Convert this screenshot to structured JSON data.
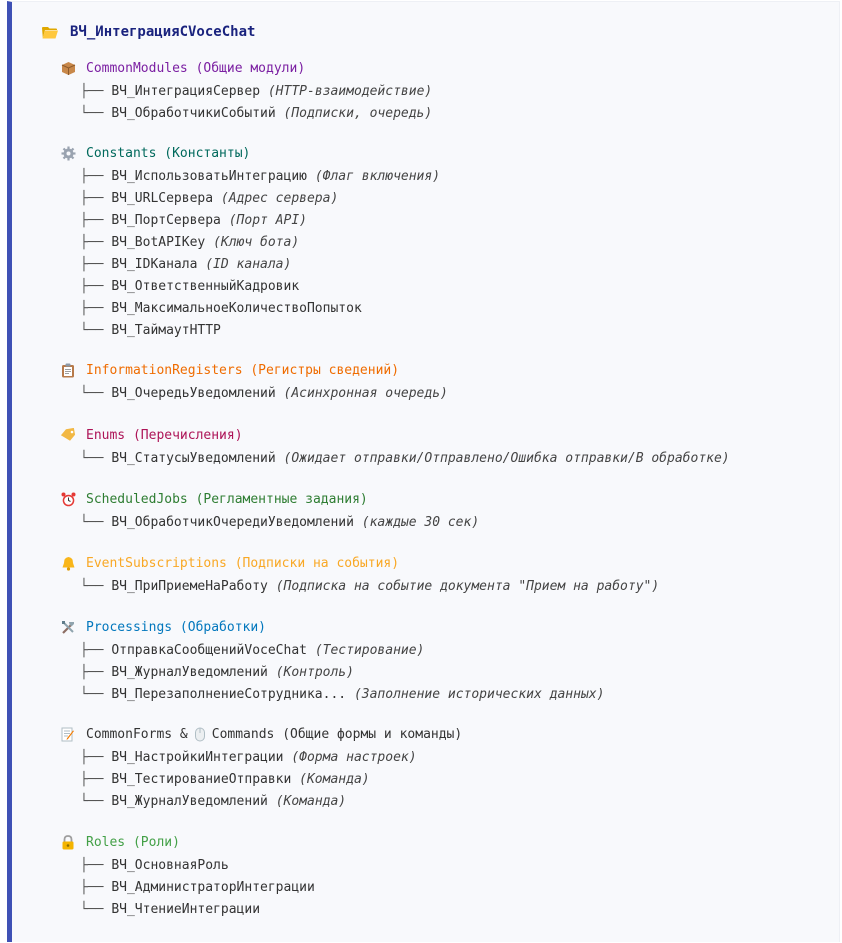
{
  "root": {
    "title": "ВЧ_ИнтеграцияCVoceChat"
  },
  "sections": [
    {
      "key": "cm",
      "color": "#7b1fa2",
      "icon": "package-icon",
      "title": "CommonModules (Общие модули)",
      "items": [
        {
          "branch": "├── ",
          "name": "ВЧ_ИнтеграцияСервер ",
          "desc": "(HTTP-взаимодействие)"
        },
        {
          "branch": "└── ",
          "name": "ВЧ_ОбработчикиСобытий ",
          "desc": "(Подписки, очередь)"
        }
      ]
    },
    {
      "key": "const",
      "color": "#00695c",
      "icon": "gear-icon",
      "title": "Constants (Константы)",
      "items": [
        {
          "branch": "├── ",
          "name": "ВЧ_ИспользоватьИнтеграцию ",
          "desc": "(Флаг включения)"
        },
        {
          "branch": "├── ",
          "name": "ВЧ_URLСервера ",
          "desc": "(Адрес сервера)"
        },
        {
          "branch": "├── ",
          "name": "ВЧ_ПортСервера ",
          "desc": "(Порт API)"
        },
        {
          "branch": "├── ",
          "name": "ВЧ_BotAPIKey ",
          "desc": "(Ключ бота)"
        },
        {
          "branch": "├── ",
          "name": "ВЧ_IDКанала ",
          "desc": "(ID канала)"
        },
        {
          "branch": "├── ",
          "name": "ВЧ_ОтветственныйКадровик",
          "desc": ""
        },
        {
          "branch": "├── ",
          "name": "ВЧ_МаксимальноеКоличествоПопыток",
          "desc": ""
        },
        {
          "branch": "└── ",
          "name": "ВЧ_ТаймаутHTTP",
          "desc": ""
        }
      ]
    },
    {
      "key": "ir",
      "color": "#ef6c00",
      "icon": "clipboard-icon",
      "title": "InformationRegisters (Регистры сведений)",
      "items": [
        {
          "branch": "└── ",
          "name": "ВЧ_ОчередьУведомлений ",
          "desc": "(Асинхронная очередь)"
        }
      ]
    },
    {
      "key": "enums",
      "color": "#ad1457",
      "icon": "tag-icon",
      "title": "Enums (Перечисления)",
      "items": [
        {
          "branch": "└── ",
          "name": "ВЧ_СтатусыУведомлений ",
          "desc": "(Ожидает отправки/Отправлено/Ошибка отправки/В обработке)"
        }
      ]
    },
    {
      "key": "sj",
      "color": "#2e7d32",
      "icon": "alarm-clock-icon",
      "title": "ScheduledJobs (Регламентные задания)",
      "items": [
        {
          "branch": "└── ",
          "name": "ВЧ_ОбработчикОчередиУведомлений ",
          "desc": "(каждые 30 сек)"
        }
      ]
    },
    {
      "key": "es",
      "color": "#f9a825",
      "icon": "bell-icon",
      "title": "EventSubscriptions (Подписки на события)",
      "items": [
        {
          "branch": "└── ",
          "name": "ВЧ_ПриПриемеНаРаботу ",
          "desc": "(Подписка на событие документа \"Прием на работу\")"
        }
      ]
    },
    {
      "key": "proc",
      "color": "#0277bd",
      "icon": "tools-icon",
      "title": "Processings (Обработки)",
      "items": [
        {
          "branch": "├── ",
          "name": "ОтправкаСообщенийVoceChat ",
          "desc": "(Тестирование)"
        },
        {
          "branch": "├── ",
          "name": "ВЧ_ЖурналУведомлений ",
          "desc": "(Контроль)"
        },
        {
          "branch": "└── ",
          "name": "ВЧ_ПерезаполнениеСотрудника... ",
          "desc": "(Заполнение исторических данных)"
        }
      ]
    },
    {
      "key": "cf",
      "color": "#333333",
      "icon": "memo-icon",
      "title": "CommonForms & ",
      "title2": " Commands (Общие формы и команды)",
      "items": [
        {
          "branch": "├── ",
          "name": "ВЧ_НастройкиИнтеграции ",
          "desc": "(Форма настроек)"
        },
        {
          "branch": "├── ",
          "name": "ВЧ_ТестированиеОтправки ",
          "desc": "(Команда)"
        },
        {
          "branch": "└── ",
          "name": "ВЧ_ЖурналУведомлений ",
          "desc": "(Команда)"
        }
      ]
    },
    {
      "key": "roles",
      "color": "#43a047",
      "icon": "lock-icon",
      "title": "Roles (Роли)",
      "items": [
        {
          "branch": "├── ",
          "name": "ВЧ_ОсновнаяРоль",
          "desc": ""
        },
        {
          "branch": "├── ",
          "name": "ВЧ_АдминистраторИнтеграции",
          "desc": ""
        },
        {
          "branch": "└── ",
          "name": "ВЧ_ЧтениеИнтеграции",
          "desc": ""
        }
      ]
    }
  ]
}
